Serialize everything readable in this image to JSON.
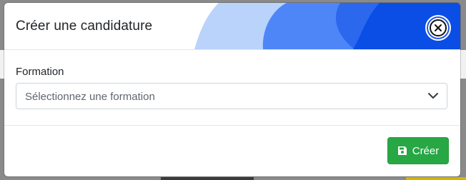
{
  "modal": {
    "title": "Créer une candidature",
    "close_icon": "close-circle-icon"
  },
  "form": {
    "formation_label": "Formation",
    "formation_placeholder": "Sélectionnez une formation"
  },
  "footer": {
    "create_label": "Créer",
    "create_icon": "save-floppy-icon"
  },
  "colors": {
    "header_accent_dark": "#0b4ee6",
    "header_accent_mid": "#4f86f7",
    "header_accent_light": "#b9d3fb",
    "create_button": "#28a745"
  }
}
